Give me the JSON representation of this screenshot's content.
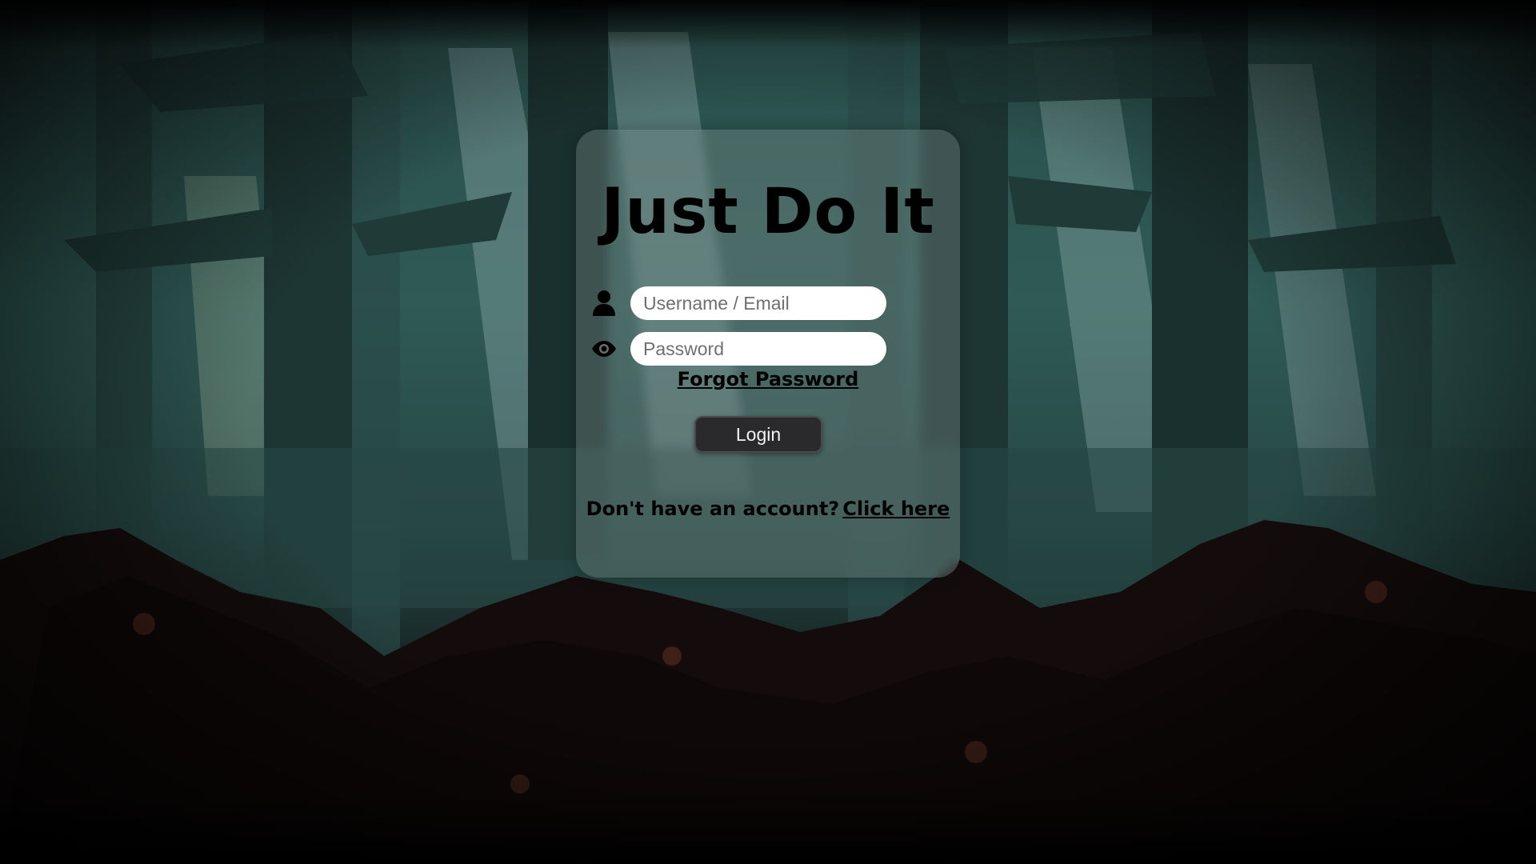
{
  "app": {
    "title": "Just Do It"
  },
  "login_form": {
    "username": {
      "placeholder": "Username / Email",
      "value": "",
      "icon": "user-icon"
    },
    "password": {
      "placeholder": "Password",
      "value": "",
      "icon": "eye-icon"
    },
    "forgot_label": "Forgot Password",
    "login_label": "Login",
    "signup_prompt": "Don't have an account?",
    "signup_link": "Click here"
  },
  "colors": {
    "card_background": "#7a8c8a",
    "button_background": "#2a2a2d",
    "button_text": "#f2f2f2",
    "input_background": "#ffffff",
    "text": "#000000"
  },
  "background": {
    "theme": "pixel-art-forest"
  }
}
